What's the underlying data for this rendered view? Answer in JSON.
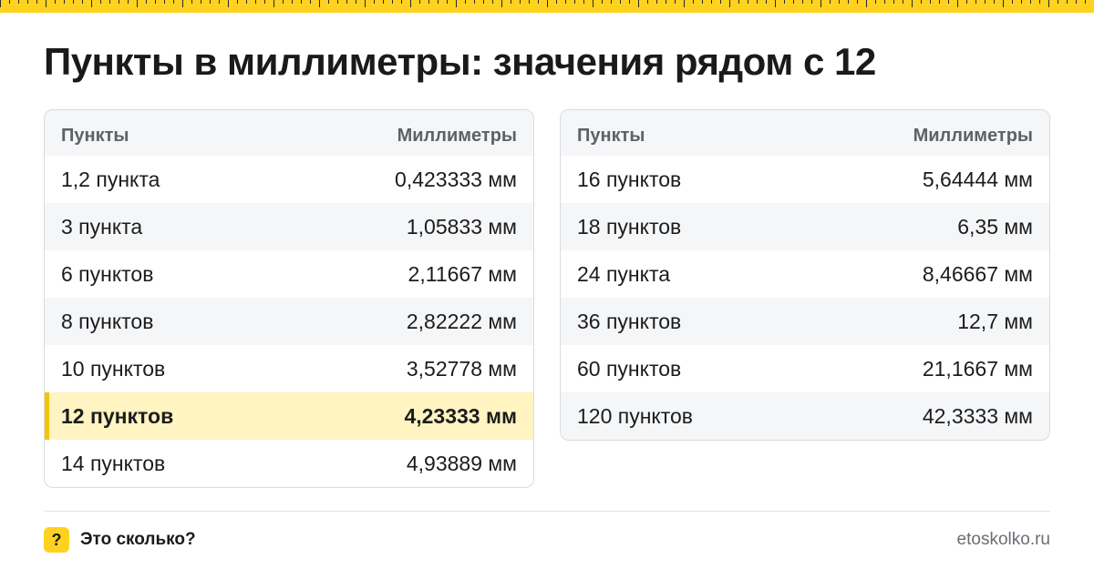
{
  "title": "Пункты в миллиметры: значения рядом с 12",
  "accent_color": "#ffd21f",
  "highlight_color": "#fff4c2",
  "left_table": {
    "header": {
      "col1": "Пункты",
      "col2": "Миллиметры"
    },
    "rows": [
      {
        "pt": "1,2 пункта",
        "mm": "0,423333 мм"
      },
      {
        "pt": "3 пункта",
        "mm": "1,05833 мм"
      },
      {
        "pt": "6 пунктов",
        "mm": "2,11667 мм"
      },
      {
        "pt": "8 пунктов",
        "mm": "2,82222 мм"
      },
      {
        "pt": "10 пунктов",
        "mm": "3,52778 мм"
      },
      {
        "pt": "12 пунктов",
        "mm": "4,23333 мм",
        "highlight": true
      },
      {
        "pt": "14 пунктов",
        "mm": "4,93889 мм"
      }
    ]
  },
  "right_table": {
    "header": {
      "col1": "Пункты",
      "col2": "Миллиметры"
    },
    "rows": [
      {
        "pt": "16 пунктов",
        "mm": "5,64444 мм"
      },
      {
        "pt": "18 пунктов",
        "mm": "6,35 мм"
      },
      {
        "pt": "24 пункта",
        "mm": "8,46667 мм"
      },
      {
        "pt": "36 пунктов",
        "mm": "12,7 мм"
      },
      {
        "pt": "60 пунктов",
        "mm": "21,1667 мм"
      },
      {
        "pt": "120 пунктов",
        "mm": "42,3333 мм"
      }
    ]
  },
  "footer": {
    "badge_symbol": "?",
    "brand": "Это сколько?",
    "site": "etoskolko.ru",
    "badge_icon": "question-icon"
  }
}
